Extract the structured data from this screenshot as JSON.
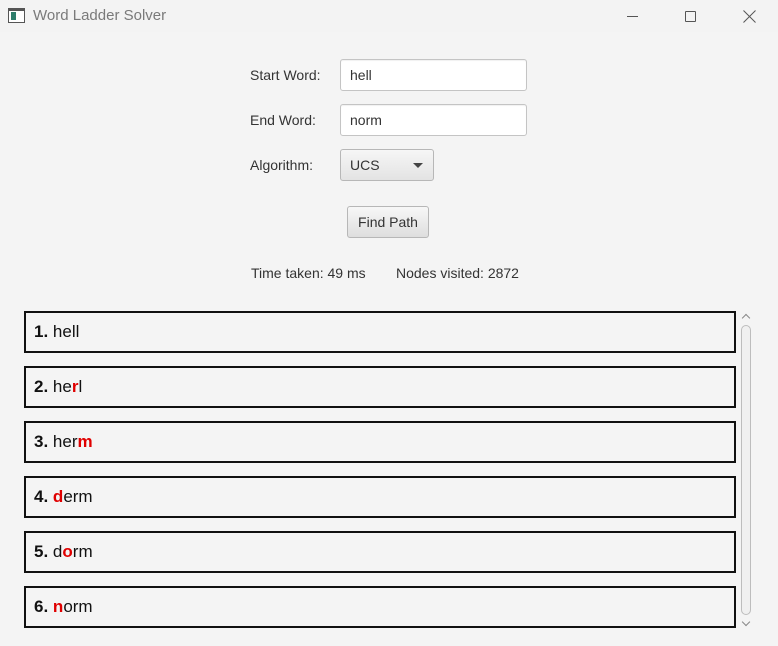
{
  "window": {
    "title": "Word Ladder Solver"
  },
  "form": {
    "start_label": "Start Word:",
    "start_value": "hell",
    "end_label": "End Word:",
    "end_value": "norm",
    "algorithm_label": "Algorithm:",
    "algorithm_value": "UCS",
    "find_button": "Find Path"
  },
  "stats": {
    "time_taken": "Time taken: 49 ms",
    "nodes_visited": "Nodes visited: 2872"
  },
  "path": [
    {
      "num": "1.",
      "pre": "hell",
      "hl": "",
      "post": ""
    },
    {
      "num": "2.",
      "pre": "he",
      "hl": "r",
      "post": "l"
    },
    {
      "num": "3.",
      "pre": "her",
      "hl": "m",
      "post": ""
    },
    {
      "num": "4.",
      "pre": "",
      "hl": "d",
      "post": "erm"
    },
    {
      "num": "5.",
      "pre": "d",
      "hl": "o",
      "post": "rm"
    },
    {
      "num": "6.",
      "pre": "",
      "hl": "n",
      "post": "orm"
    }
  ],
  "colors": {
    "highlight": "#e00000",
    "border": "#111111"
  }
}
